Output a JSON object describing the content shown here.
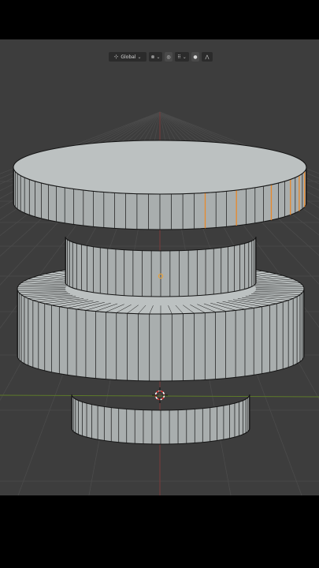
{
  "toolbar": {
    "transform_orientation": "Global",
    "orientation_icon": "transform-axes-icon",
    "pivot_icon": "pivot-point-icon",
    "snap_icon": "snap-icon",
    "snap_target_icon": "snap-increment-icon",
    "proportional_icon": "proportional-editing-icon",
    "falloff_icon": "falloff-curve-icon"
  },
  "colors": {
    "viewport_bg": "#3d3d3d",
    "grid": "#4b4b4b",
    "mesh_face": "#a9aeae",
    "mesh_top": "#bcc1c1",
    "edge": "#151515",
    "selected_edge": "#e8892b",
    "x_axis": "#7a3a3a",
    "y_axis": "#5d7a2a",
    "origin": "#e8a23a",
    "cursor_a": "#d33",
    "cursor_b": "#fff"
  }
}
